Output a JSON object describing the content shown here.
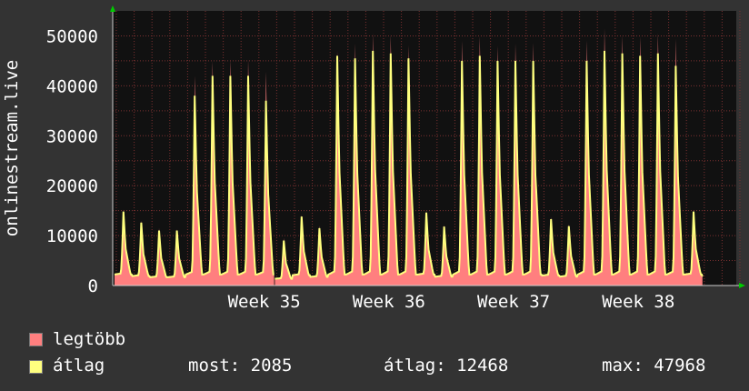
{
  "chart_data": {
    "type": "area",
    "ylabel": "onlinestream.live",
    "y_ticks": [
      "0",
      "10000",
      "20000",
      "30000",
      "40000",
      "50000"
    ],
    "ylim": [
      0,
      55000
    ],
    "x_ticks": [
      "Week 35",
      "Week 36",
      "Week 37",
      "Week 38"
    ],
    "grid": true,
    "series": [
      {
        "name": "legtöbb",
        "color": "#ff7f7f",
        "daily_peaks": [
          15200,
          13000,
          11500,
          11300,
          42000,
          45000,
          45300,
          45300,
          42800,
          9500,
          14200,
          12000,
          47000,
          48500,
          50600,
          50300,
          48100,
          15000,
          12200,
          49000,
          50000,
          48000,
          48500,
          48600,
          13700,
          12300,
          49100,
          51500,
          50200,
          49900,
          50600,
          49400,
          15200
        ]
      },
      {
        "name": "átlag",
        "color": "#ffff7f",
        "daily_peaks": [
          14800,
          12600,
          11000,
          11000,
          38000,
          42000,
          42000,
          42000,
          37000,
          9000,
          13800,
          11500,
          46000,
          45500,
          47000,
          46500,
          45500,
          14600,
          11800,
          45000,
          46000,
          45000,
          45000,
          45000,
          13300,
          11900,
          45000,
          47000,
          46500,
          46000,
          46500,
          44000,
          14800
        ]
      }
    ]
  },
  "legend": {
    "max_label": "legtöbb",
    "avg_label": "átlag"
  },
  "stats": {
    "current": "most: 2085",
    "average": "átlag: 12468",
    "maximum": "max: 47968"
  },
  "colors": {
    "background": "#333333",
    "plot_bg": "#111111",
    "grid": "#7a3030",
    "max_fill": "#ff7f7f",
    "avg_line": "#ffff7f",
    "axis_arrow": "#00cc00"
  }
}
